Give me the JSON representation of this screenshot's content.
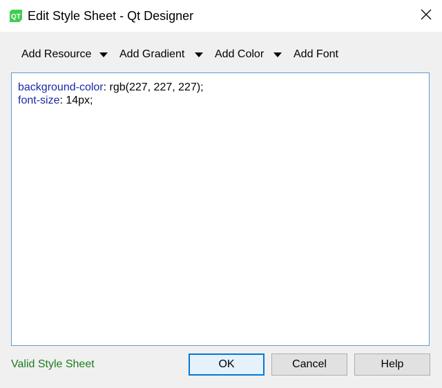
{
  "window": {
    "title": "Edit Style Sheet - Qt Designer",
    "app_icon_text": "QT",
    "icon_names": {
      "app": "qt-designer-icon",
      "close": "close-icon"
    }
  },
  "toolbar": {
    "items": [
      {
        "label": "Add Resource",
        "has_dropdown": true
      },
      {
        "label": "Add Gradient",
        "has_dropdown": true
      },
      {
        "label": "Add Color",
        "has_dropdown": true
      },
      {
        "label": "Add Font",
        "has_dropdown": false
      }
    ]
  },
  "editor": {
    "lines": [
      {
        "property": "background-color",
        "sep": ": ",
        "value": "rgb(227, 227, 227);"
      },
      {
        "property": "font-size",
        "sep": ": ",
        "value": "14px;"
      }
    ]
  },
  "footer": {
    "status": "Valid Style Sheet",
    "ok_label": "OK",
    "cancel_label": "Cancel",
    "help_label": "Help"
  },
  "colors": {
    "property_blue": "#1a2aa6",
    "status_green": "#1f7a1f",
    "focus_border": "#0078d7",
    "qt_green": "#41cd52"
  }
}
